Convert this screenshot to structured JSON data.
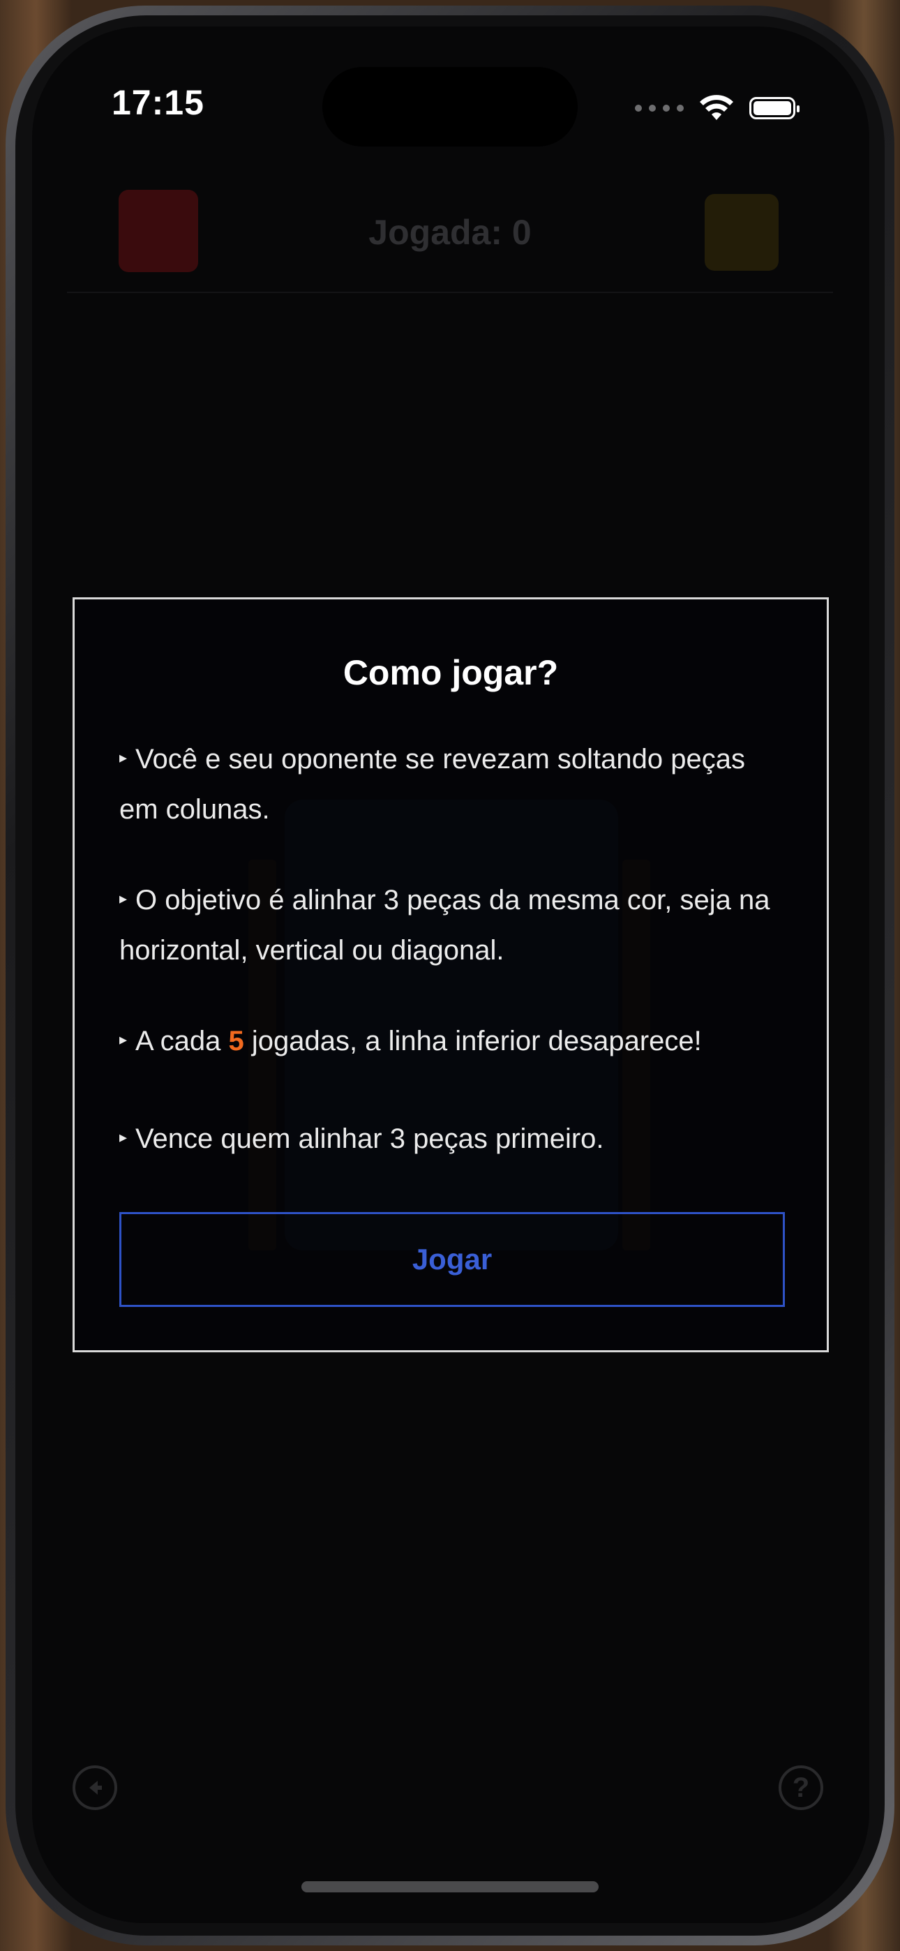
{
  "status_bar": {
    "time": "17:15"
  },
  "game_header": {
    "turn_label": "Jogada: 0"
  },
  "modal": {
    "title": "Como jogar?",
    "bullet": "▸",
    "rule1": "Você e seu oponente se revezam soltando peças em colunas.",
    "rule2": "O objetivo é alinhar 3 peças da mesma cor, seja na horizontal, vertical ou diagonal.",
    "rule3_before": "A cada",
    "rule3_number": "5",
    "rule3_after": "jogadas, a linha inferior desaparece!",
    "rule4": "Vence quem alinhar 3 peças primeiro.",
    "play_button": "Jogar"
  },
  "bottom_bar": {
    "back_icon": "back-arrow-icon",
    "help_icon": "question-mark-icon",
    "help_glyph": "?"
  },
  "colors": {
    "accent_blue": "#2e52c6",
    "highlight_orange": "#f26a1f",
    "player1_red": "#3a0b0d",
    "player2_yellow": "#231d08"
  }
}
